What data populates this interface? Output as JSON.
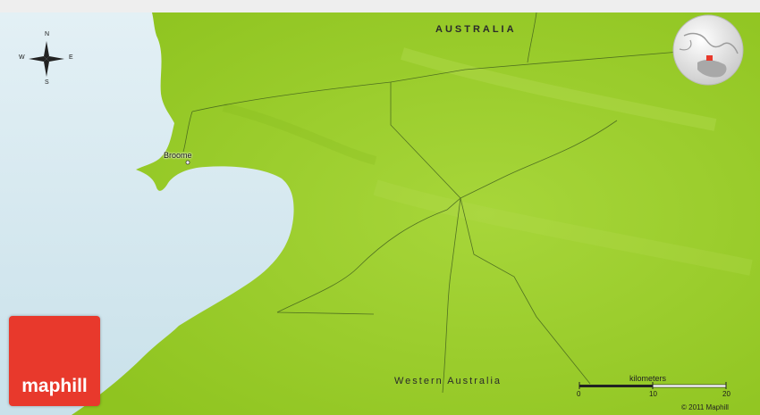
{
  "map": {
    "country_label": "AUSTRALIA",
    "region_label": "Western Australia",
    "city_label": "Broome",
    "compass": {
      "north": "N",
      "south": "S",
      "west": "W",
      "east": "E"
    },
    "colors": {
      "sea": "#d3e8ef",
      "land": "#9acc28",
      "land_light": "#b8de4a",
      "logo": "#e8392c"
    }
  },
  "scale": {
    "title": "kilometers",
    "ticks": [
      "0",
      "10",
      "20"
    ]
  },
  "brand": {
    "logo_text": "maphill",
    "copyright": "© 2011 Maphill"
  },
  "inset": {
    "icon": "globe-locator-icon"
  }
}
